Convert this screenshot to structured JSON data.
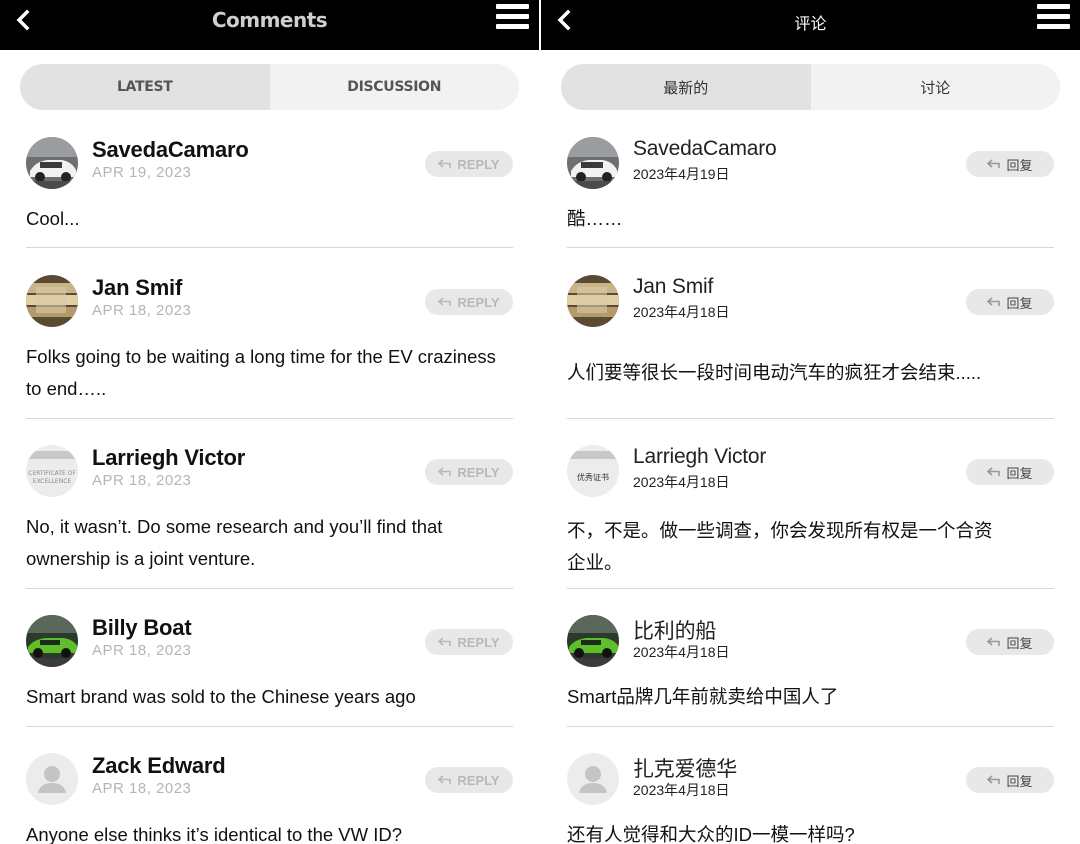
{
  "colors": {
    "header_bg": "#000000",
    "segment_active": "#e2e2e2",
    "segment_inactive": "#f2f2f2",
    "reply_bg": "#e8e8e8",
    "date_gray": "#b5b5b5"
  },
  "left": {
    "header": {
      "title": "Comments",
      "back_icon": "chevron-left-icon",
      "menu_icon": "hamburger-menu-icon"
    },
    "tabs": [
      "LATEST",
      "DISCUSSION"
    ],
    "reply_label": "REPLY",
    "comments": [
      {
        "name": "SavedaCamaro",
        "date": "APR 19, 2023",
        "text": "Cool..."
      },
      {
        "name": "Jan Smif",
        "date": "APR 18, 2023",
        "text": "Folks going to be waiting a long time for the EV craziness to end….."
      },
      {
        "name": "Larriegh Victor",
        "date": "APR 18, 2023",
        "text": "No, it wasn’t. Do some research and you’ll find that ownership is a joint venture."
      },
      {
        "name": "Billy Boat",
        "date": "APR 18, 2023",
        "text": "Smart brand was sold to the Chinese years ago"
      },
      {
        "name": "Zack Edward",
        "date": "APR 18, 2023",
        "text": "Anyone else thinks it’s identical to the VW ID?"
      }
    ]
  },
  "right": {
    "header": {
      "title": "评论",
      "back_icon": "chevron-left-icon",
      "menu_icon": "hamburger-menu-icon"
    },
    "tabs": [
      "最新的",
      "讨论"
    ],
    "reply_label": "回复",
    "comments": [
      {
        "name": "SavedaCamaro",
        "date": "2023年4月19日",
        "text": "酷……"
      },
      {
        "name": "Jan Smif",
        "date": "2023年4月18日",
        "text": "人们要等很长一段时间电动汽车的疯狂才会结束....."
      },
      {
        "name": "Larriegh Victor",
        "date": "2023年4月18日",
        "text": "不，不是。做一些调查，你会发现所有权是一个合资企业。"
      },
      {
        "name": "比利的船",
        "date": "2023年4月18日",
        "text": "Smart品牌几年前就卖给中国人了"
      },
      {
        "name": "扎克爱德华",
        "date": "2023年4月18日",
        "text": "还有人觉得和大众的ID一模一样吗?"
      }
    ]
  },
  "avatars": [
    "car-avatar",
    "gold-coins-avatar",
    "certificate-avatar",
    "green-car-avatar",
    "default-user-avatar"
  ],
  "certificate_avatar_text": {
    "left": "CERTIFICATE OF EXCELLENCE",
    "right": "优秀证书"
  }
}
